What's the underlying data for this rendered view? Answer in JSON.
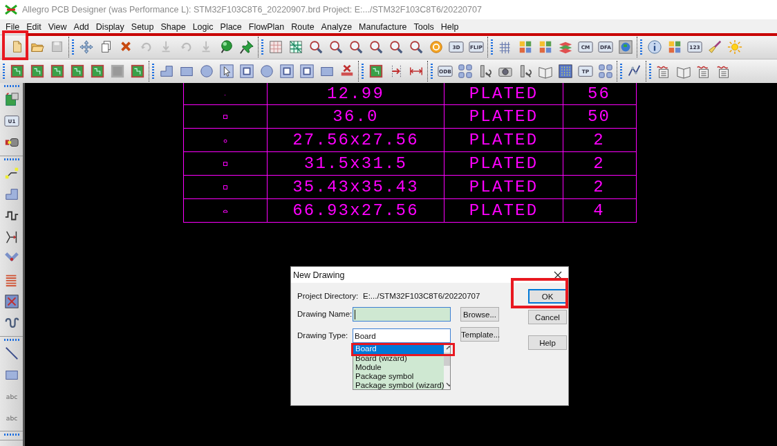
{
  "window": {
    "title": "Allegro PCB Designer (was Performance L): STM32F103C8T6_20220907.brd  Project: E:.../STM32F103C8T6/20220707"
  },
  "menu": [
    "File",
    "Edit",
    "View",
    "Add",
    "Display",
    "Setup",
    "Shape",
    "Logic",
    "Place",
    "FlowPlan",
    "Route",
    "Analyze",
    "Manufacture",
    "Tools",
    "Help"
  ],
  "icon_texts": [
    "3D",
    "FLIP",
    "CM",
    "DFA",
    "123",
    "ODB",
    "TP",
    "U1",
    "abc",
    "abc"
  ],
  "drill_table": {
    "rows": [
      {
        "kind": "dot",
        "column_2": "12.99",
        "column_3": "PLATED",
        "column_4": "56"
      },
      {
        "kind": "square",
        "column_2": "36.0",
        "column_3": "PLATED",
        "column_4": "50"
      },
      {
        "kind": "circle",
        "column_2": "27.56x27.56",
        "column_3": "PLATED",
        "column_4": "2"
      },
      {
        "kind": "square",
        "column_2": "31.5x31.5",
        "column_3": "PLATED",
        "column_4": "2"
      },
      {
        "kind": "square",
        "column_2": "35.43x35.43",
        "column_3": "PLATED",
        "column_4": "2"
      },
      {
        "kind": "dome",
        "column_2": "66.93x27.56",
        "column_3": "PLATED",
        "column_4": "4"
      }
    ]
  },
  "dialog": {
    "title": "New Drawing",
    "project_directory": {
      "label": "Project Directory:",
      "value": "E:.../STM32F103C8T6/20220707"
    },
    "drawing_name": {
      "label": "Drawing Name:",
      "focused": true
    },
    "drawing_type": {
      "label": "Drawing Type:",
      "value": "Board",
      "options": [
        {
          "label": "Board",
          "selected": true
        },
        {
          "label": "Board (wizard)",
          "selected": false
        },
        {
          "label": "Module",
          "selected": false
        },
        {
          "label": "Package symbol",
          "selected": false
        },
        {
          "label": "Package symbol (wizard)",
          "selected": false
        }
      ]
    },
    "field_buttons": [
      {
        "label": "Browse..."
      },
      {
        "label": "Template..."
      }
    ],
    "buttons": [
      {
        "label": "OK",
        "default": true
      },
      {
        "label": "Cancel",
        "default": false
      },
      {
        "label": "Help",
        "default": false
      }
    ]
  }
}
